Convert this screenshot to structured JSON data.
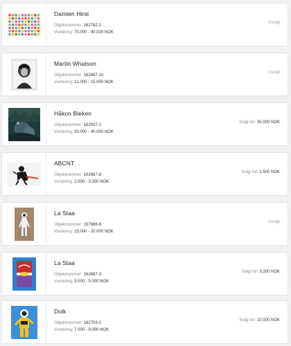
{
  "labels": {
    "object_number": "Objektnummer:",
    "valuation": "Vurdering:"
  },
  "items": [
    {
      "artist": "Damien Hirst",
      "object_number": "162762-1",
      "valuation": "70.000 - 90.000 NOK",
      "status": "Usolgt",
      "sold_label": "",
      "price": "",
      "thumb": "dot-painting"
    },
    {
      "artist": "Martin Whatson",
      "object_number": "162687-10",
      "valuation": "12.000 - 15.000 NOK",
      "status": "Usolgt",
      "sold_label": "",
      "price": "",
      "thumb": "portrait-print"
    },
    {
      "artist": "Håkon Bleken",
      "object_number": "162507-1",
      "valuation": "30.000 - 40.000 NOK",
      "status": "",
      "sold_label": "Solgt for:",
      "price": "35.000 NOK",
      "thumb": "dark-painting"
    },
    {
      "artist": "ABCNT",
      "object_number": "162687-8",
      "valuation": "2.000 - 3.000 NOK",
      "status": "",
      "sold_label": "Solgt for:",
      "price": "1.500 NOK",
      "thumb": "figure-print"
    },
    {
      "artist": "La Staa",
      "object_number": "157688-6",
      "valuation": "15.000 - 20.000 NOK",
      "status": "Usolgt",
      "sold_label": "",
      "price": "",
      "thumb": "stencil-wood"
    },
    {
      "artist": "La Staa",
      "object_number": "162687-3",
      "valuation": "3.000 - 5.000 NOK",
      "status": "",
      "sold_label": "Solgt for:",
      "price": "3.200 NOK",
      "thumb": "soup-can"
    },
    {
      "artist": "Dolk",
      "object_number": "162703-1",
      "valuation": "7.000 - 9.000 NOK",
      "status": "",
      "sold_label": "Solgt for:",
      "price": "10.000 NOK",
      "thumb": "astronaut"
    }
  ]
}
